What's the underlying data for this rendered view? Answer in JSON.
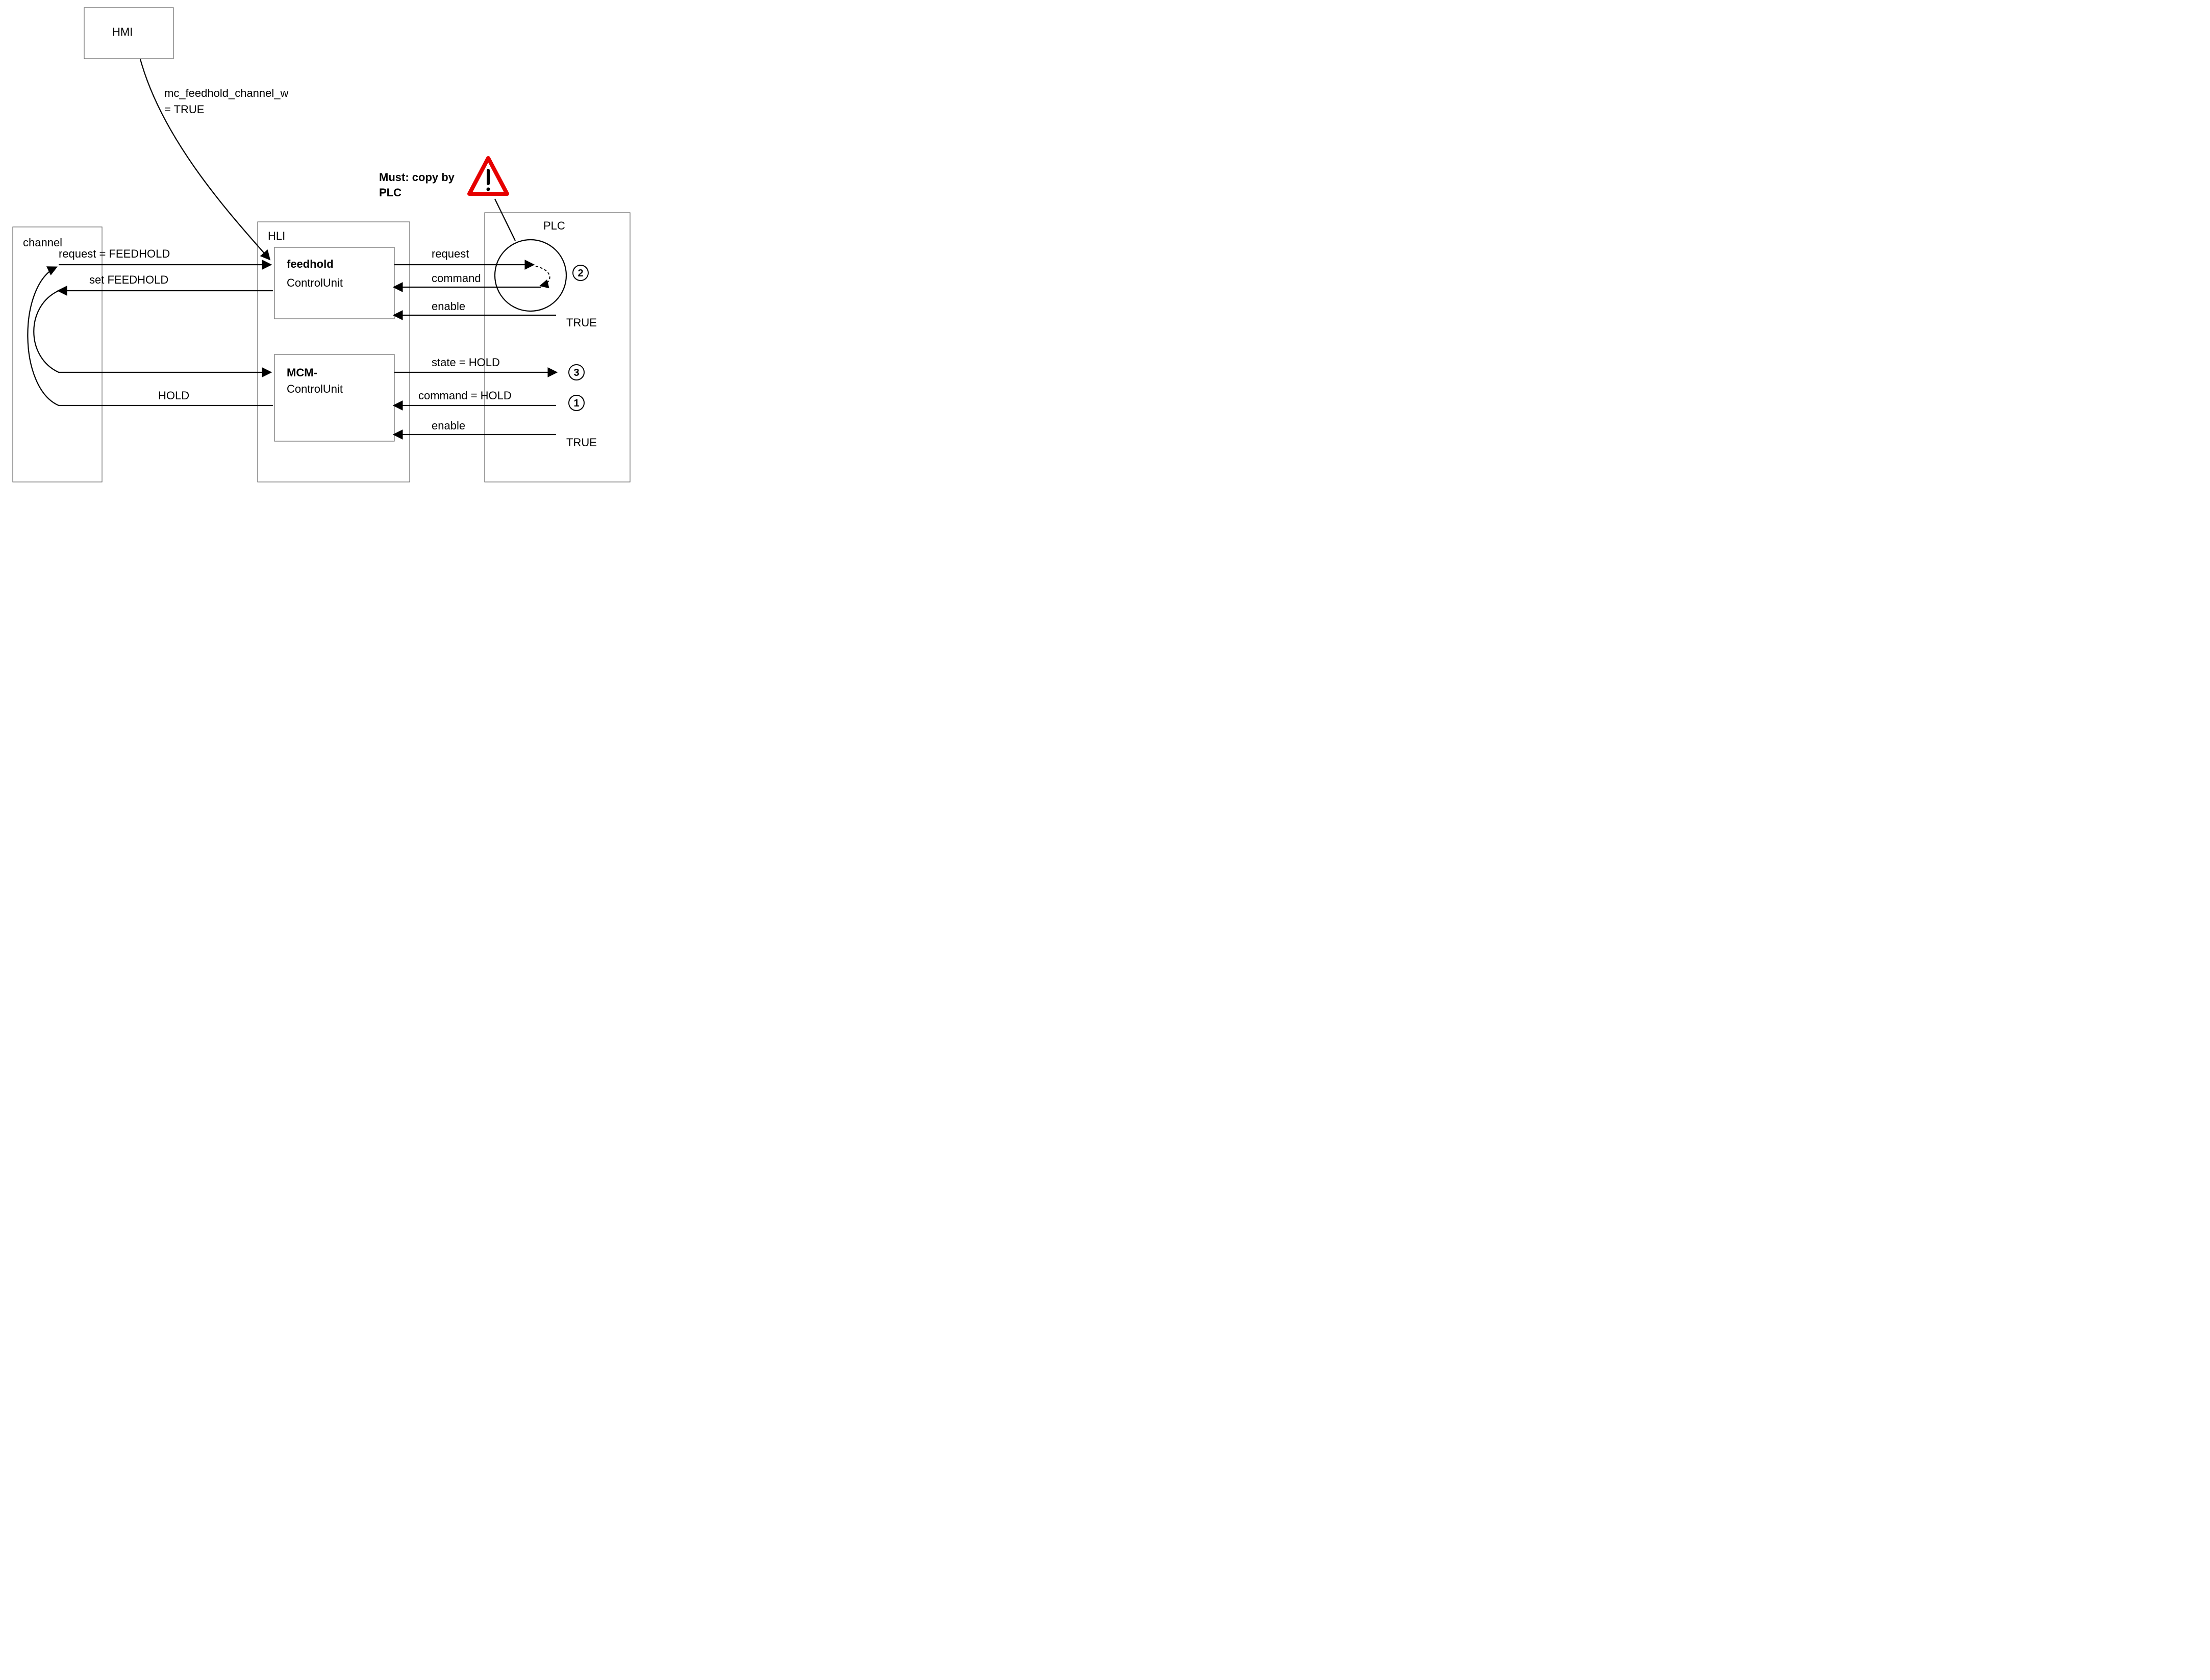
{
  "boxes": {
    "hmi": "HMI",
    "channel": "channel",
    "hli": "HLI",
    "plc": "PLC",
    "feedhold_title": "feedhold",
    "feedhold_sub": "ControlUnit",
    "mcm_title": "MCM-",
    "mcm_sub": "ControlUnit"
  },
  "edges": {
    "hmi_out_line1": "mc_feedhold_channel_w",
    "hmi_out_line2": "= TRUE",
    "warning_line1": "Must: copy by",
    "warning_line2": "PLC",
    "ch_to_fh": "request = FEEDHOLD",
    "fh_to_ch": "set FEEDHOLD",
    "fh_to_plc_req": "request",
    "plc_to_fh_cmd": "command",
    "plc_to_fh_en": "enable",
    "fh_en_true": "TRUE",
    "mcm_state": "state = HOLD",
    "mcm_cmd": "command = HOLD",
    "mcm_hold_back": "HOLD",
    "mcm_en": "enable",
    "mcm_en_true": "TRUE"
  },
  "steps": {
    "s1": "1",
    "s2": "2",
    "s3": "3"
  },
  "warning_icon": "warning-triangle-icon"
}
